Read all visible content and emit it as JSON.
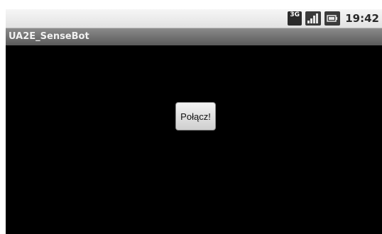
{
  "status_bar": {
    "network_type": "3G",
    "time": "19:42",
    "icons": [
      "network-3g-icon",
      "signal-strength-icon",
      "battery-icon"
    ]
  },
  "title_bar": {
    "title": "UA2E_SenseBot"
  },
  "main": {
    "connect_button_label": "Połącz!"
  },
  "colors": {
    "background": "#000000",
    "status_bar": "#e8e8e8",
    "title_bar": "#707070",
    "button": "#e0e0e0"
  }
}
